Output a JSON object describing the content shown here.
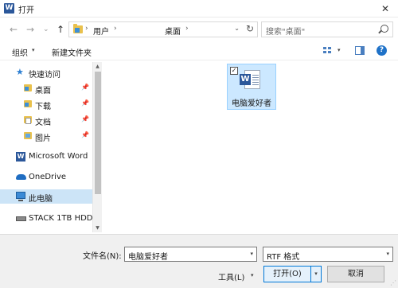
{
  "window": {
    "title": "打开",
    "app_icon_letter": "W",
    "close_glyph": "✕"
  },
  "nav": {
    "back_glyph": "←",
    "forward_glyph": "→",
    "recent_glyph": "⌄",
    "up_glyph": "↑"
  },
  "address": {
    "crumbs": [
      "用户",
      "桌面"
    ],
    "separator": "›",
    "dropdown_glyph": "⌄",
    "refresh_glyph": "↻"
  },
  "search": {
    "placeholder": "搜索\"桌面\""
  },
  "toolbar": {
    "organize_label": "组织",
    "new_folder_label": "新建文件夹",
    "dropdown_glyph": "▾"
  },
  "sidebar": {
    "pin_glyph": "📌",
    "quick_access": {
      "label": "快速访问",
      "icon_glyph": "★"
    },
    "items": [
      {
        "label": "桌面"
      },
      {
        "label": "下载"
      },
      {
        "label": "文档"
      },
      {
        "label": "图片"
      }
    ],
    "word": {
      "label": "Microsoft Word",
      "icon_letter": "W"
    },
    "onedrive": {
      "label": "OneDrive"
    },
    "this_pc": {
      "label": "此电脑"
    },
    "drive": {
      "label": "STACK 1TB HDD"
    },
    "scroll_up_glyph": "▲",
    "scroll_down_glyph": "▼"
  },
  "content": {
    "files": [
      {
        "name": "电脑爱好者",
        "checked_glyph": "✓",
        "icon_letter": "W"
      }
    ]
  },
  "bottom": {
    "filename_label": "文件名(N):",
    "filename_value": "电脑爱好者",
    "filetype_value": "RTF 格式",
    "dropdown_glyph": "▾",
    "tools_label": "工具(L)",
    "open_label": "打开(O)",
    "cancel_label": "取消",
    "grip_glyph": "⋰"
  },
  "colors": {
    "accent": "#0078d7",
    "selection": "#cce8ff",
    "word_blue": "#2b579a",
    "folder": "#e9c14d"
  }
}
